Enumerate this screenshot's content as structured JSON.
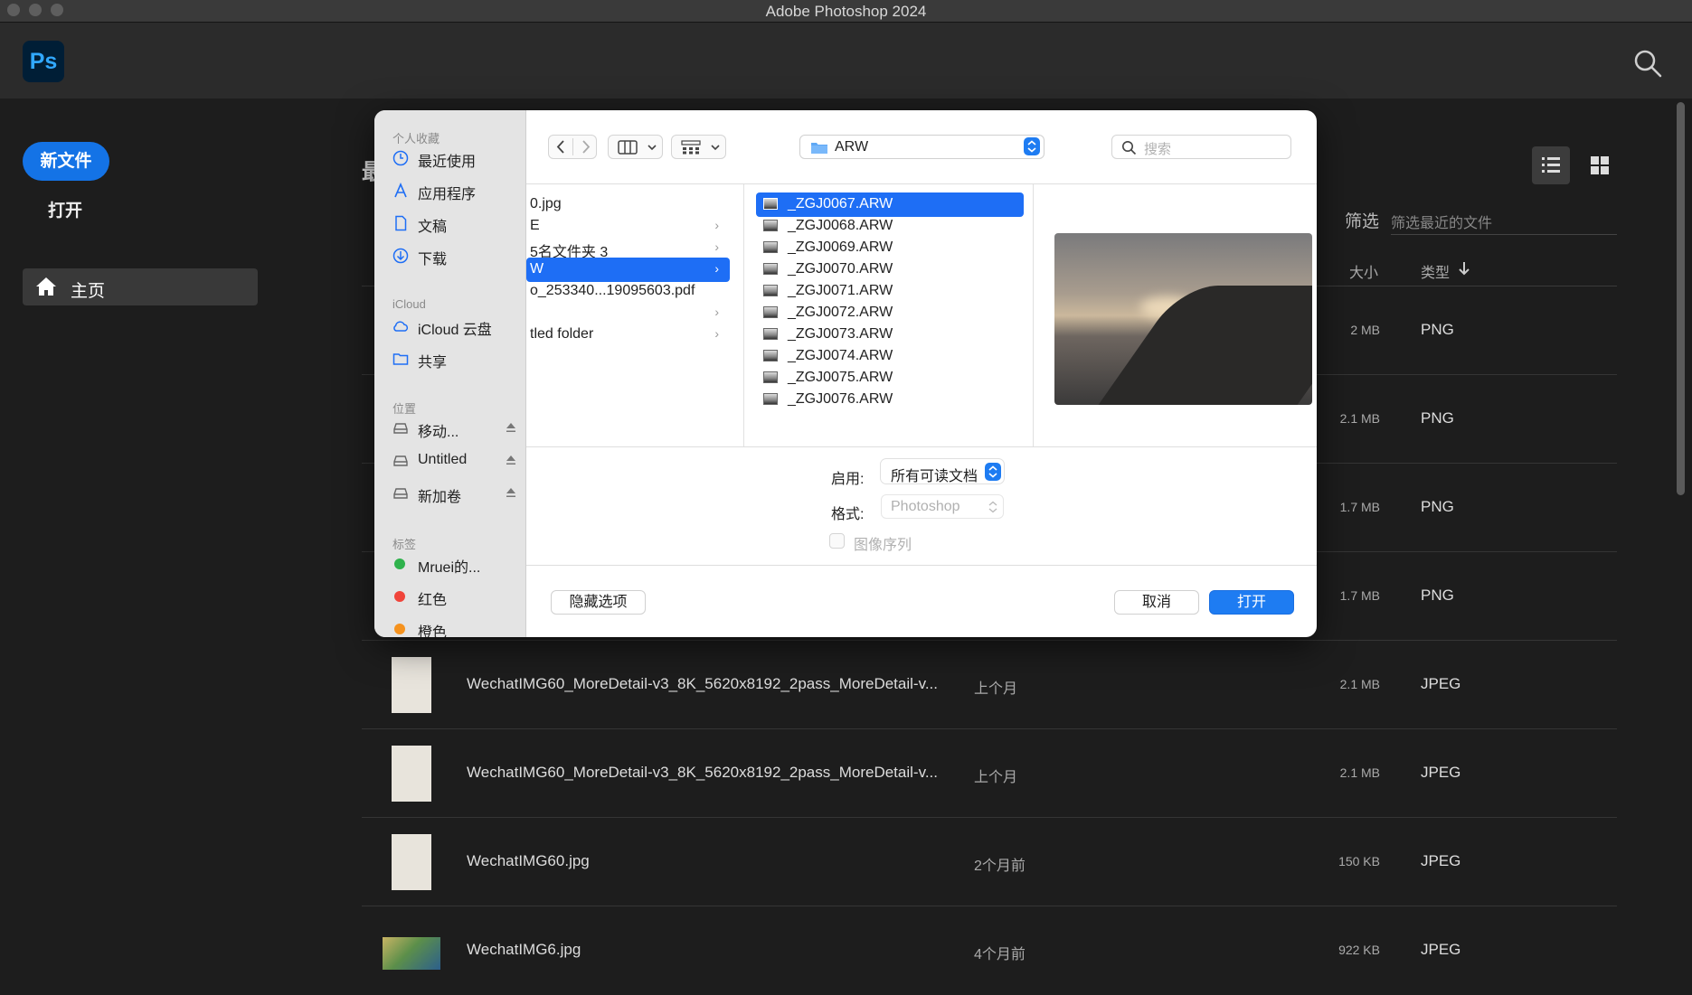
{
  "window": {
    "title": "Adobe Photoshop 2024"
  },
  "app": {
    "logo_text": "Ps"
  },
  "nav": {
    "new_file": "新文件",
    "open": "打开",
    "home": "主页"
  },
  "main": {
    "section_title": "最",
    "filter_label": "筛选",
    "filter_placeholder": "筛选最近的文件",
    "col_size": "大小",
    "col_type": "类型",
    "rows": [
      {
        "name": "",
        "date": "",
        "size": "2 MB",
        "type": "PNG"
      },
      {
        "name": "",
        "date": "",
        "size": "2.1 MB",
        "type": "PNG"
      },
      {
        "name": "",
        "date": "",
        "size": "1.7 MB",
        "type": "PNG"
      },
      {
        "name": "",
        "date": "",
        "size": "1.7 MB",
        "type": "PNG"
      },
      {
        "name": "WechatIMG60_MoreDetail-v3_8K_5620x8192_2pass_MoreDetail-v...",
        "date": "上个月",
        "size": "2.1 MB",
        "type": "JPEG"
      },
      {
        "name": "WechatIMG60_MoreDetail-v3_8K_5620x8192_2pass_MoreDetail-v...",
        "date": "上个月",
        "size": "2.1 MB",
        "type": "JPEG"
      },
      {
        "name": "WechatIMG60.jpg",
        "date": "2个月前",
        "size": "150 KB",
        "type": "JPEG"
      },
      {
        "name": "WechatIMG6.jpg",
        "date": "4个月前",
        "size": "922 KB",
        "type": "JPEG"
      }
    ]
  },
  "dialog": {
    "sidebar": {
      "favorites_head": "个人收藏",
      "favorites": [
        "最近使用",
        "应用程序",
        "文稿",
        "下载"
      ],
      "icloud_head": "iCloud",
      "icloud": [
        "iCloud 云盘",
        "共享"
      ],
      "locations_head": "位置",
      "locations": [
        "移动...",
        "Untitled",
        "新加卷"
      ],
      "tags_head": "标签",
      "tags": [
        "Mruei的...",
        "红色",
        "橙色"
      ]
    },
    "path": "ARW",
    "search_placeholder": "搜索",
    "column1": [
      {
        "label": "0.jpg",
        "folder": false
      },
      {
        "label": "E",
        "folder": true
      },
      {
        "label": "5名文件夹 3",
        "folder": true
      },
      {
        "label": "W",
        "folder": true,
        "selected": true
      },
      {
        "label": "o_253340...19095603.pdf",
        "folder": false
      },
      {
        "label": "",
        "folder": true
      },
      {
        "label": "tled folder",
        "folder": true
      }
    ],
    "files": [
      "_ZGJ0067.ARW",
      "_ZGJ0068.ARW",
      "_ZGJ0069.ARW",
      "_ZGJ0070.ARW",
      "_ZGJ0071.ARW",
      "_ZGJ0072.ARW",
      "_ZGJ0073.ARW",
      "_ZGJ0074.ARW",
      "_ZGJ0075.ARW",
      "_ZGJ0076.ARW"
    ],
    "enable_label": "启用:",
    "enable_value": "所有可读文档",
    "format_label": "格式:",
    "format_value": "Photoshop",
    "image_sequence": "图像序列",
    "hide_options": "隐藏选项",
    "cancel": "取消",
    "open": "打开"
  }
}
